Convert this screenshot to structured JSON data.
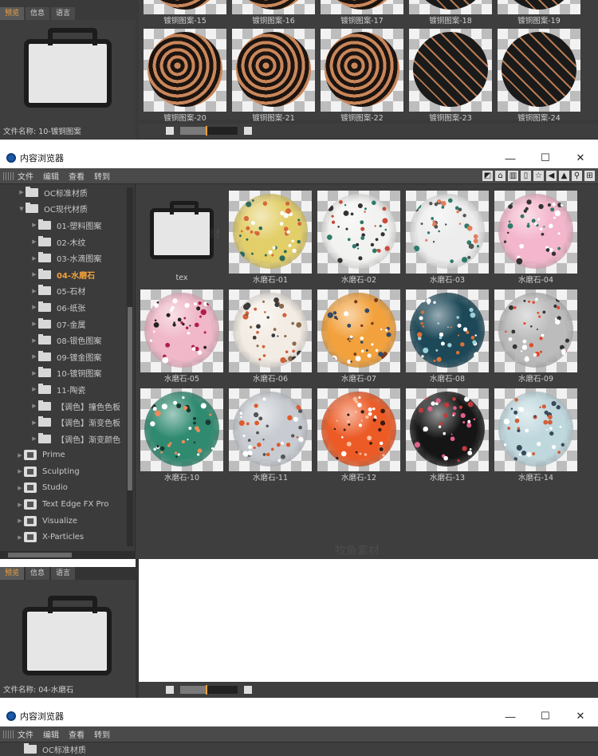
{
  "top_panel": {
    "tabs": [
      "预览",
      "信息",
      "语言"
    ],
    "captions_row1": [
      "镀铜图案-15",
      "镀铜图案-16",
      "镀铜图案-17",
      "镀铜图案-18",
      "镀铜图案-19"
    ],
    "captions_row2": [
      "镀铜图案-20",
      "镀铜图案-21",
      "镀铜图案-22",
      "镀铜图案-23",
      "镀铜图案-24"
    ],
    "filename": "文件名称:  10-镀铜图案"
  },
  "window": {
    "title": "内容浏览器",
    "controls": {
      "minimize": "—",
      "maximize": "☐",
      "close": "✕"
    },
    "menu": [
      "文件",
      "编辑",
      "查看",
      "转到"
    ]
  },
  "tree": {
    "items": [
      {
        "label": "OC标准材质",
        "icon": "folder-icon",
        "indent": 1
      },
      {
        "label": "OC现代材质",
        "icon": "folder-open-icon",
        "indent": 1
      },
      {
        "label": "01-塑料图案",
        "icon": "folder-icon",
        "indent": 2
      },
      {
        "label": "02-木纹",
        "icon": "folder-icon",
        "indent": 2
      },
      {
        "label": "03-水滴图案",
        "icon": "folder-icon",
        "indent": 2
      },
      {
        "label": "04-水磨石",
        "icon": "folder-icon",
        "indent": 2,
        "active": true
      },
      {
        "label": "05-石材",
        "icon": "folder-icon",
        "indent": 2
      },
      {
        "label": "06-纸张",
        "icon": "folder-icon",
        "indent": 2
      },
      {
        "label": "07-金属",
        "icon": "folder-icon",
        "indent": 2
      },
      {
        "label": "08-银色图案",
        "icon": "folder-icon",
        "indent": 2
      },
      {
        "label": "09-镀金图案",
        "icon": "folder-icon",
        "indent": 2
      },
      {
        "label": "10-镀铜图案",
        "icon": "folder-icon",
        "indent": 2
      },
      {
        "label": "11-陶瓷",
        "icon": "folder-icon",
        "indent": 2
      },
      {
        "label": "【调色】撞色色板",
        "icon": "folder-icon",
        "indent": 2
      },
      {
        "label": "【调色】渐变色板",
        "icon": "folder-icon",
        "indent": 2
      },
      {
        "label": "【调色】渐变颜色",
        "icon": "folder-icon",
        "indent": 2
      },
      {
        "label": "Prime",
        "icon": "library-icon",
        "indent": 0
      },
      {
        "label": "Sculpting",
        "icon": "library-icon",
        "indent": 0
      },
      {
        "label": "Studio",
        "icon": "library-icon",
        "indent": 0
      },
      {
        "label": "Text Edge FX Pro",
        "icon": "library-icon",
        "indent": 0
      },
      {
        "label": "Visualize",
        "icon": "library-icon",
        "indent": 0
      },
      {
        "label": "X-Particles",
        "icon": "library-icon",
        "indent": 0
      }
    ]
  },
  "grid": {
    "items": [
      {
        "caption": "tex",
        "type": "folder"
      },
      {
        "caption": "水磨石-01",
        "base": "#e3cf6a",
        "dots": [
          "#2f6b5a",
          "#d46a3a",
          "#ffffff"
        ]
      },
      {
        "caption": "水磨石-02",
        "base": "#f2f2f0",
        "dots": [
          "#2c7a6a",
          "#333333",
          "#c94a3a"
        ]
      },
      {
        "caption": "水磨石-03",
        "base": "#ededed",
        "dots": [
          "#2c7a6a",
          "#555555",
          "#e08060"
        ]
      },
      {
        "caption": "水磨石-04",
        "base": "#f4b6cc",
        "dots": [
          "#ffffff",
          "#333333",
          "#2c7a6a"
        ]
      },
      {
        "caption": "水磨石-05",
        "base": "#f0b8c8",
        "dots": [
          "#b0204a",
          "#ffffff",
          "#222222"
        ]
      },
      {
        "caption": "水磨石-06",
        "base": "#f3ece4",
        "dots": [
          "#d0603a",
          "#3a3a3a",
          "#8a6a4a"
        ]
      },
      {
        "caption": "水磨石-07",
        "base": "#f2a13c",
        "dots": [
          "#ffffff",
          "#2f4a6a",
          "#7a3a1a"
        ]
      },
      {
        "caption": "水磨石-08",
        "base": "#1c4858",
        "dots": [
          "#ffffff",
          "#e07030",
          "#9ad0d8"
        ]
      },
      {
        "caption": "水磨石-09",
        "base": "#bcbcbc",
        "dots": [
          "#e04a2a",
          "#ffffff",
          "#333333"
        ]
      },
      {
        "caption": "水磨石-10",
        "base": "#2f8a70",
        "dots": [
          "#ffffff",
          "#1a3a30",
          "#f08a5a"
        ]
      },
      {
        "caption": "水磨石-11",
        "base": "#c8ccd2",
        "dots": [
          "#e05a2a",
          "#ffffff",
          "#555555"
        ]
      },
      {
        "caption": "水磨石-12",
        "base": "#ec5b26",
        "dots": [
          "#ffffff",
          "#3a1a10",
          "#f7c0a0"
        ]
      },
      {
        "caption": "水磨石-13",
        "base": "#151515",
        "dots": [
          "#ffffff",
          "#e0608a",
          "#c03a3a"
        ]
      },
      {
        "caption": "水磨石-14",
        "base": "#bfd8de",
        "dots": [
          "#ffffff",
          "#3a4a5a",
          "#d0603a"
        ]
      }
    ]
  },
  "bottom": {
    "tabs": [
      "预览",
      "信息",
      "语言"
    ],
    "filename": "文件名称:  04-水磨石",
    "zoom_level": 0.45
  },
  "colors": {
    "accent": "#f2a13a",
    "panel": "#3e3e3e"
  },
  "watermark": "牧鱼素材"
}
